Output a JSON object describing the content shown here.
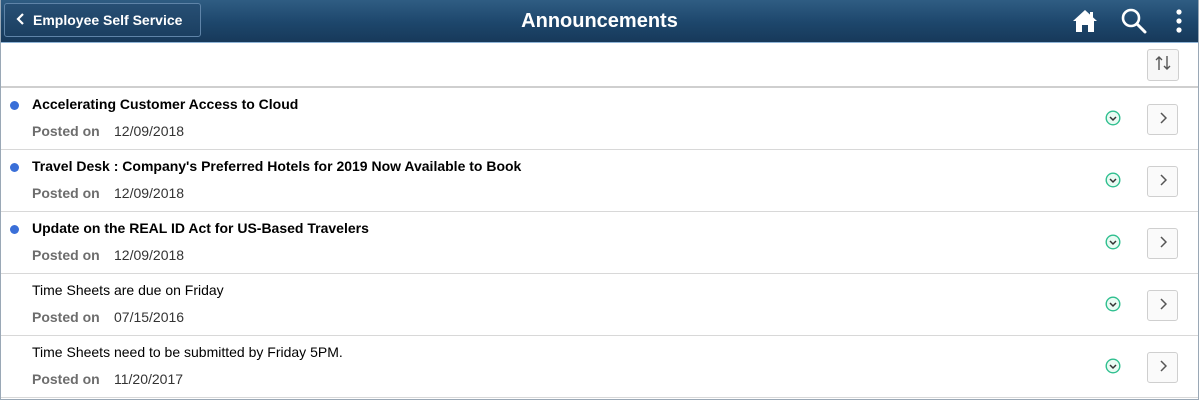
{
  "header": {
    "back_label": "Employee Self Service",
    "title": "Announcements",
    "icons": [
      "home-icon",
      "search-icon",
      "more-vertical-icon"
    ]
  },
  "toolbar": {
    "sort_icon": "sort-arrows-icon"
  },
  "posted_label": "Posted on",
  "colors": {
    "header_bg": "#1d466b",
    "unread_dot": "#3a6fd8",
    "expand_icon": "#2fbf8f"
  },
  "announcements": [
    {
      "title": "Accelerating Customer Access to Cloud",
      "date": "12/09/2018",
      "unread": true
    },
    {
      "title": "Travel Desk : Company's Preferred Hotels for 2019 Now Available to Book",
      "date": "12/09/2018",
      "unread": true
    },
    {
      "title": "Update on the REAL ID Act for US-Based Travelers",
      "date": "12/09/2018",
      "unread": true
    },
    {
      "title": "Time Sheets are due on Friday",
      "date": "07/15/2016",
      "unread": false
    },
    {
      "title": "Time Sheets need to be submitted by Friday 5PM.",
      "date": "11/20/2017",
      "unread": false
    }
  ]
}
